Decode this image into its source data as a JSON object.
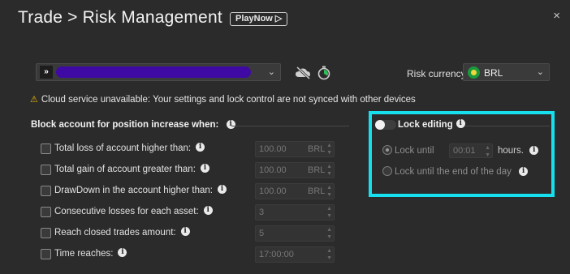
{
  "header": {
    "title": "Trade > Risk Management",
    "playnow_label": "PlayNow ▷",
    "close_icon": "×"
  },
  "account": {
    "logo": "»",
    "selected_value": "",
    "chevron": "⌄"
  },
  "risk_currency": {
    "label": "Risk currency",
    "value": "BRL",
    "flag_icon": "brazil-flag-icon",
    "chevron": "⌄"
  },
  "warning": {
    "icon": "⚠",
    "text": "Cloud service unavailable: Your settings and lock control are not synced with other devices"
  },
  "block_section": {
    "title": "Block account for position increase when:",
    "rows": [
      {
        "label": "Total loss of account higher than:",
        "value": "100.00",
        "unit": "BRL"
      },
      {
        "label": "Total gain of account greater than:",
        "value": "100.00",
        "unit": "BRL"
      },
      {
        "label": "DrawDown in the account higher than:",
        "value": "100.00",
        "unit": "BRL"
      },
      {
        "label": "Consecutive losses for each asset:",
        "value": "3",
        "unit": ""
      },
      {
        "label": "Reach closed trades amount:",
        "value": "5",
        "unit": ""
      },
      {
        "label": "Time reaches:",
        "value": "17:00:00",
        "unit": ""
      }
    ]
  },
  "lock_section": {
    "title": "Lock editing",
    "lock_until_label": "Lock until",
    "lock_until_value": "00:01",
    "hours_label": "hours.",
    "end_of_day_label": "Lock until the end of the day"
  },
  "info_glyph": "i",
  "colors": {
    "background": "#2b2b2b",
    "highlight": "#16e0ee",
    "account_bar": "#3f0aa3",
    "warning": "#f0b400"
  }
}
